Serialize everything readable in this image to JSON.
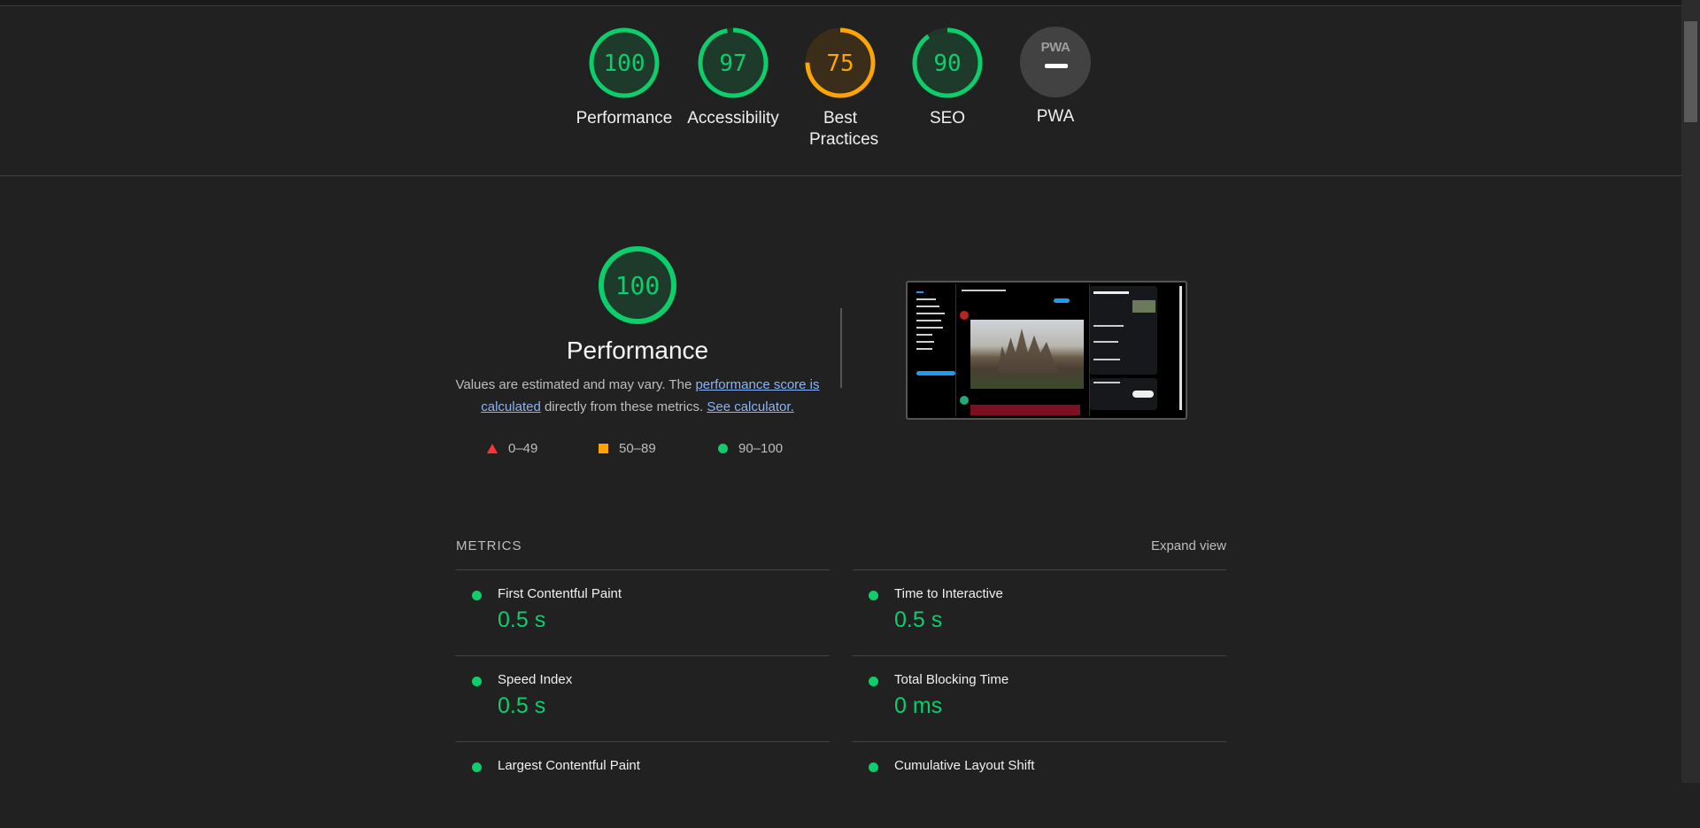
{
  "categories": [
    {
      "score": "100",
      "label": "Performance",
      "status": "pass"
    },
    {
      "score": "97",
      "label": "Accessibility",
      "status": "pass"
    },
    {
      "score": "75",
      "label": "Best Practices",
      "status": "average"
    },
    {
      "score": "90",
      "label": "SEO",
      "status": "pass"
    }
  ],
  "pwa": {
    "badge_text": "PWA",
    "label": "PWA"
  },
  "performance": {
    "score": "100",
    "title": "Performance",
    "desc_prefix": "Values are estimated and may vary. The ",
    "desc_link1": "performance score is calculated",
    "desc_middle": " directly from these metrics. ",
    "desc_link2": "See calculator."
  },
  "legend": {
    "fail": "0–49",
    "average": "50–89",
    "pass": "90–100"
  },
  "metrics": {
    "title": "METRICS",
    "expand_label": "Expand view",
    "items": [
      {
        "name": "First Contentful Paint",
        "value": "0.5 s"
      },
      {
        "name": "Time to Interactive",
        "value": "0.5 s"
      },
      {
        "name": "Speed Index",
        "value": "0.5 s"
      },
      {
        "name": "Total Blocking Time",
        "value": "0 ms"
      },
      {
        "name": "Largest Contentful Paint",
        "value": ""
      },
      {
        "name": "Cumulative Layout Shift",
        "value": ""
      }
    ]
  },
  "colors": {
    "pass": "#0cce6b",
    "average": "#ffa400",
    "fail": "#ff3333",
    "background": "#212121"
  }
}
